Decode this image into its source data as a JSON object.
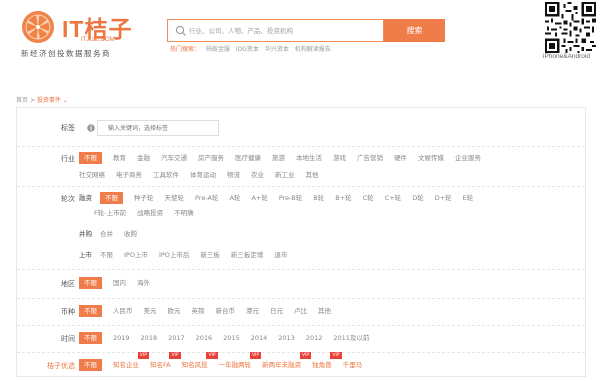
{
  "logo": {
    "brand": "IT桔子",
    "domain": "ITJUZI.COM",
    "slogan": "新经济创投数据服务商"
  },
  "search": {
    "placeholder": "行业、公司、人物、产品、投资机构",
    "button_label": "搜索"
  },
  "hot": {
    "label": "热门搜索：",
    "items": [
      "蚂蚁金服",
      "IDG资本",
      "华兴资本",
      "机构解读报告"
    ]
  },
  "qr": {
    "label": "iPhone&Android"
  },
  "breadcrumb": {
    "home": "首页",
    "sep": ">",
    "current": "投资事件",
    "chevron": "⌄"
  },
  "filters": {
    "tag": {
      "label": "标签",
      "placeholder": "输入关键词，选择标签"
    },
    "industry": {
      "label": "行业",
      "line1": [
        "不限",
        "教育",
        "金融",
        "汽车交通",
        "房产服务",
        "医疗健康",
        "旅游",
        "本地生活",
        "游戏",
        "广告营销",
        "硬件",
        "文娱传媒",
        "企业服务"
      ],
      "line2": [
        "社交网络",
        "电子商务",
        "工具软件",
        "体育运动",
        "物流",
        "农业",
        "新工业",
        "其他"
      ]
    },
    "round": {
      "label": "轮次",
      "financing_label": "融资",
      "financing1": [
        "不限",
        "种子轮",
        "天使轮",
        "Pre-A轮",
        "A轮",
        "A+轮",
        "Pre-B轮",
        "B轮",
        "B+轮",
        "C轮",
        "C+轮",
        "D轮",
        "D+轮",
        "E轮"
      ],
      "financing2": [
        "F轮-上市前",
        "战略投资",
        "不明确"
      ],
      "merger_label": "并购",
      "merger": [
        "合并",
        "收购"
      ],
      "ipo_label": "上市",
      "ipo": [
        "不限",
        "IPO上市",
        "IPO上市后",
        "新三板",
        "新三板定增",
        "退市"
      ]
    },
    "region": {
      "label": "地区",
      "items": [
        "不限",
        "国内",
        "海外"
      ]
    },
    "currency": {
      "label": "币种",
      "items": [
        "不限",
        "人民币",
        "美元",
        "欧元",
        "英镑",
        "新台币",
        "港元",
        "日元",
        "卢比",
        "其他"
      ]
    },
    "time": {
      "label": "时间",
      "items": [
        "不限",
        "2019",
        "2018",
        "2017",
        "2016",
        "2015",
        "2014",
        "2013",
        "2012",
        "2011及以前"
      ]
    },
    "juzi": {
      "label": "桔子优选",
      "items": [
        "不限",
        "知名企业",
        "知名FA",
        "知名风投",
        "一年融两轮",
        "新两年未融资",
        "独角兽",
        "千里马"
      ],
      "vip_badge": "VIP"
    }
  },
  "colors": {
    "accent": "#f07c4a",
    "vip": "#e8413b"
  }
}
